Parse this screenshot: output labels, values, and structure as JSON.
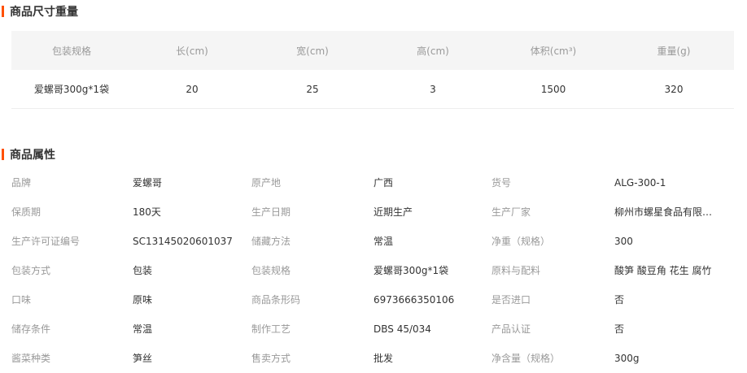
{
  "size_section": {
    "title": "商品尺寸重量",
    "headers": [
      "包装规格",
      "长(cm)",
      "宽(cm)",
      "高(cm)",
      "体积(cm³)",
      "重量(g)"
    ],
    "row": [
      "爱螺哥300g*1袋",
      "20",
      "25",
      "3",
      "1500",
      "320"
    ]
  },
  "attr_section": {
    "title": "商品属性",
    "rows": [
      [
        [
          "品牌",
          "爱螺哥"
        ],
        [
          "原产地",
          "广西"
        ],
        [
          "货号",
          "ALG-300-1"
        ]
      ],
      [
        [
          "保质期",
          "180天"
        ],
        [
          "生产日期",
          "近期生产"
        ],
        [
          "生产厂家",
          "柳州市螺星食品有限公司"
        ]
      ],
      [
        [
          "生产许可证编号",
          "SC13145020601037"
        ],
        [
          "储藏方法",
          "常温"
        ],
        [
          "净重（规格）",
          "300"
        ]
      ],
      [
        [
          "包装方式",
          "包装"
        ],
        [
          "包装规格",
          "爱螺哥300g*1袋"
        ],
        [
          "原料与配料",
          "酸笋 酸豆角 花生 腐竹"
        ]
      ],
      [
        [
          "口味",
          "原味"
        ],
        [
          "商品条形码",
          "6973666350106"
        ],
        [
          "是否进口",
          "否"
        ]
      ],
      [
        [
          "储存条件",
          "常温"
        ],
        [
          "制作工艺",
          "DBS 45/034"
        ],
        [
          "产品认证",
          "否"
        ]
      ],
      [
        [
          "酱菜种类",
          "笋丝"
        ],
        [
          "售卖方式",
          "批发"
        ],
        [
          "净含量（规格）",
          "300g"
        ]
      ]
    ]
  },
  "colors": {
    "accent": "#ff5000",
    "label": "#999999",
    "text": "#333333",
    "header_bg": "#f5f5f5",
    "divider": "#eeeeee"
  }
}
